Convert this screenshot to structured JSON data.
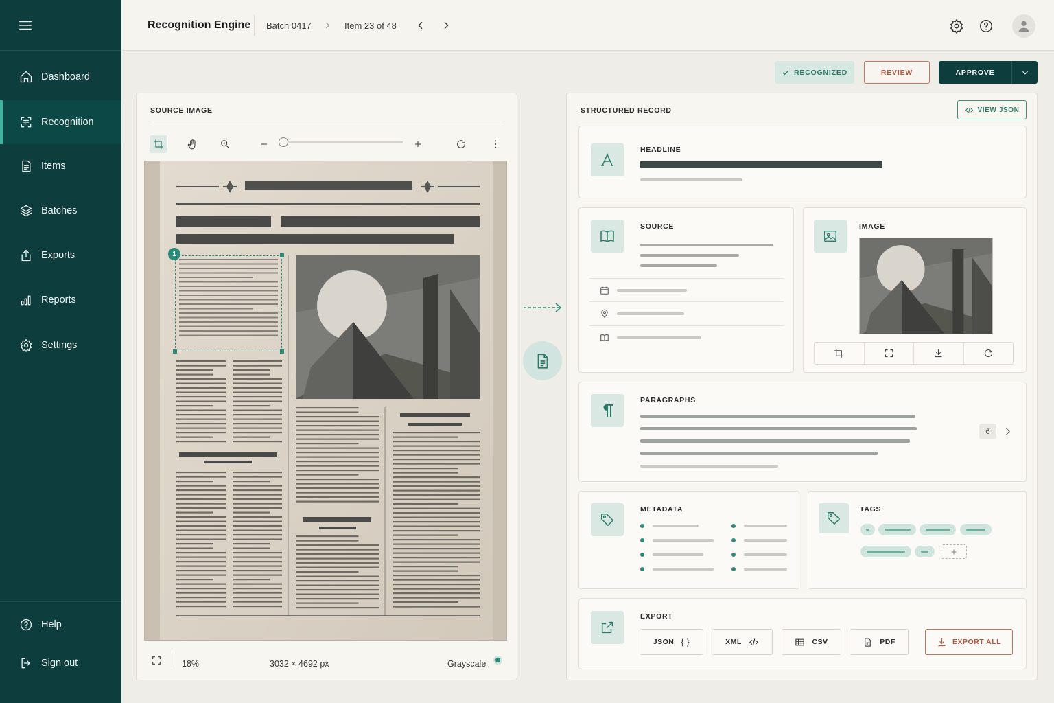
{
  "sidebar": {
    "items": [
      {
        "label": "Dashboard",
        "icon": "home-icon"
      },
      {
        "label": "Recognition",
        "icon": "scan-icon",
        "active": true
      },
      {
        "label": "Items",
        "icon": "document-icon"
      },
      {
        "label": "Batches",
        "icon": "layers-icon"
      },
      {
        "label": "Exports",
        "icon": "upload-icon"
      },
      {
        "label": "Reports",
        "icon": "bar-chart-icon"
      },
      {
        "label": "Settings",
        "icon": "gear-icon"
      }
    ],
    "help_label": "Help",
    "signout_label": "Sign out"
  },
  "header": {
    "title": "Recognition Engine",
    "batch": "Batch 0417",
    "item": "Item 23 of 48"
  },
  "actions": {
    "recognized_label": "RECOGNIZED",
    "review_label": "REVIEW",
    "approve_label": "APPROVE"
  },
  "source_panel": {
    "title": "SOURCE IMAGE",
    "region_number": "1",
    "zoom": "18%",
    "dimensions": "3032 × 4692 px",
    "mode": "Grayscale"
  },
  "record_panel": {
    "title": "STRUCTURED RECORD",
    "view_json_label": "VIEW JSON",
    "headline_label": "HEADLINE",
    "source_label": "SOURCE",
    "image_label": "IMAGE",
    "paragraphs_label": "PARAGRAPHS",
    "paragraphs_count": "6",
    "metadata_label": "METADATA",
    "tags_label": "TAGS",
    "export_label": "EXPORT",
    "export_formats": [
      "JSON",
      "XML",
      "CSV",
      "PDF"
    ],
    "export_all_label": "EXPORT ALL"
  },
  "colors": {
    "sidebar": "#0e3d3d",
    "accent": "#2e8a78",
    "review": "#b45a3f",
    "background": "#efede7"
  }
}
